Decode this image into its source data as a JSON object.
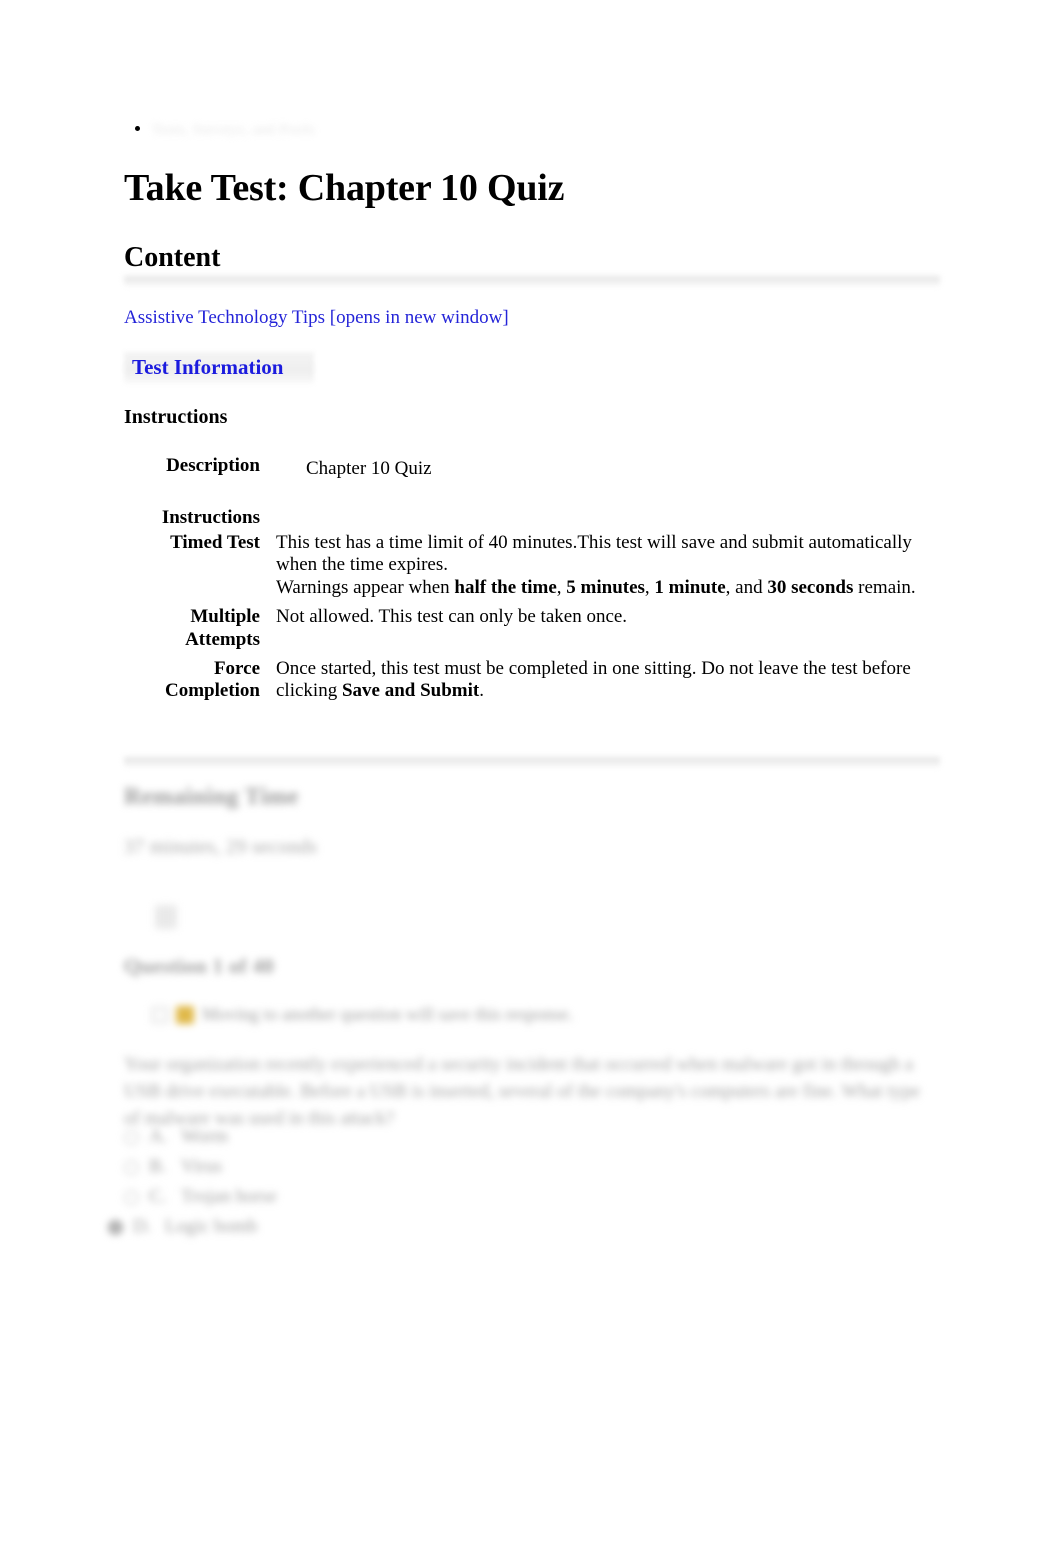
{
  "breadcrumb": {
    "item_label": "Tests, Surveys, and Pools"
  },
  "page_title": "Take Test: Chapter 10 Quiz",
  "content_heading": "Content",
  "assistive_link": "Assistive Technology Tips [opens in new window]",
  "test_information": {
    "title": "Test Information",
    "instructions_heading": "Instructions"
  },
  "info_rows": {
    "description_label": "Description",
    "description_value": "Chapter 10 Quiz",
    "instructions_label": "Instructions",
    "timed_test_label": "Timed Test",
    "timed_test_line1_a": "This test has a time limit of 40 minutes.This test will save and submit automatically when the time expires.",
    "timed_test_line2_pre": "Warnings appear when ",
    "timed_test_b1": "half the time",
    "timed_test_sep1": ", ",
    "timed_test_b2": "5 minutes",
    "timed_test_sep2": ", ",
    "timed_test_b3": "1 minute",
    "timed_test_sep3": ", and ",
    "timed_test_b4": "30 seconds",
    "timed_test_line2_post": " remain.",
    "multiple_attempts_label": "Multiple Attempts",
    "multiple_attempts_value": "Not allowed. This test can only be taken once.",
    "force_completion_label": "Force Completion",
    "force_completion_pre": "Once started, this test must be completed in one sitting. Do not leave the test before clicking ",
    "force_completion_bold": "Save and Submit",
    "force_completion_post": "."
  },
  "timer": {
    "remaining_label": "Remaining Time",
    "remaining_value": "37 minutes, 29 seconds"
  },
  "question": {
    "number_label": "Question 1 of 40",
    "save_notice": "Moving to another question will save this response.",
    "text": "Your organization recently experienced a security incident that occurred when malware got in through a USB drive executable. Before a USB is inserted, several of the company's computers are fine. What type of malware was used in this attack?",
    "options": [
      {
        "letter": "A.",
        "label": "Worm",
        "selected": false
      },
      {
        "letter": "B.",
        "label": "Virus",
        "selected": false
      },
      {
        "letter": "C.",
        "label": "Trojan horse",
        "selected": false
      },
      {
        "letter": "D.",
        "label": "Logic bomb",
        "selected": true
      }
    ]
  },
  "colors": {
    "link": "#2424d8",
    "section_title": "#1b1bde",
    "divider": "#e8e8e8",
    "save_icon": "#e0b94a"
  }
}
